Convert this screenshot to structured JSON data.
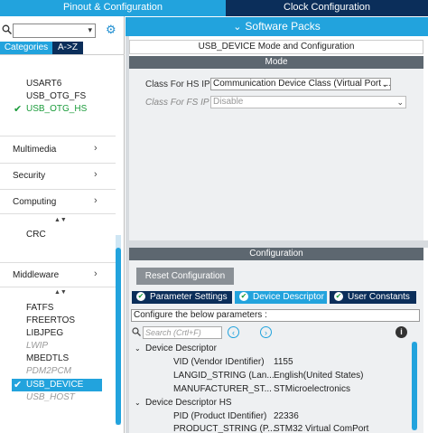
{
  "tabs": {
    "pinout": "Pinout & Configuration",
    "clock": "Clock Configuration"
  },
  "software_packs": {
    "chevron": "⌄",
    "label": "Software Packs"
  },
  "left": {
    "search": {
      "value": "",
      "dropdown": "▾"
    },
    "category_tabs": {
      "categories": "Categories",
      "az": "A->Z"
    },
    "connectivity_items": [
      {
        "label": "USART6",
        "state": "normal"
      },
      {
        "label": "USB_OTG_FS",
        "state": "normal"
      },
      {
        "label": "USB_OTG_HS",
        "state": "enabled"
      }
    ],
    "sections": {
      "multimedia": "Multimedia",
      "security": "Security",
      "computing": "Computing",
      "middleware": "Middleware"
    },
    "chevron": "›",
    "sort_arrow": "▲▼",
    "computing_items": [
      {
        "label": "CRC",
        "state": "normal"
      }
    ],
    "middleware_items": [
      {
        "label": "FATFS",
        "state": "normal"
      },
      {
        "label": "FREERTOS",
        "state": "normal"
      },
      {
        "label": "LIBJPEG",
        "state": "normal"
      },
      {
        "label": "LWIP",
        "state": "disabled"
      },
      {
        "label": "MBEDTLS",
        "state": "normal"
      },
      {
        "label": "PDM2PCM",
        "state": "disabled"
      },
      {
        "label": "USB_DEVICE",
        "state": "selected-enabled"
      },
      {
        "label": "USB_HOST",
        "state": "disabled"
      }
    ]
  },
  "right": {
    "title": "USB_DEVICE Mode and Configuration",
    "mode": {
      "header": "Mode",
      "fields": [
        {
          "label": "Class For HS IP",
          "value": "Communication Device Class (Virtual Port ...",
          "enabled": true
        },
        {
          "label": "Class For FS IP",
          "value": "Disable",
          "enabled": false
        }
      ]
    },
    "configuration": {
      "header": "Configuration",
      "reset_button": "Reset Configuration",
      "tabs": [
        {
          "label": "Parameter Settings",
          "active": false
        },
        {
          "label": "Device Descriptor",
          "active": true
        },
        {
          "label": "User Constants",
          "active": false
        }
      ],
      "info": "Configure the below parameters :",
      "search_placeholder": "Search (Crtl+F)",
      "groups": [
        {
          "title": "Device Descriptor",
          "params": [
            {
              "name": "VID (Vendor IDentifier)",
              "value": "1155"
            },
            {
              "name": "LANGID_STRING (Lan...",
              "value": "English(United States)"
            },
            {
              "name": "MANUFACTURER_ST...",
              "value": "STMicroelectronics"
            }
          ]
        },
        {
          "title": "Device Descriptor HS",
          "params": [
            {
              "name": "PID (Product IDentifier)",
              "value": "22336"
            },
            {
              "name": "PRODUCT_STRING (P...",
              "value": "STM32 Virtual ComPort"
            }
          ]
        }
      ]
    }
  },
  "colors": {
    "accent": "#22a3dd",
    "dark": "#0b2e5a",
    "enabled": "#1a9b3a"
  }
}
